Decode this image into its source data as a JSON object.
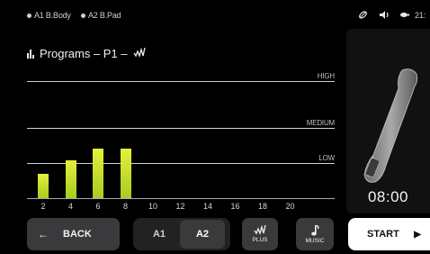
{
  "status": {
    "tag_a1": "A1 B.Body",
    "tag_a2": "A2 B.Pad",
    "clock": "21:"
  },
  "header": {
    "title": "Programs – P1 –"
  },
  "chart_data": {
    "type": "bar",
    "x_ticks": [
      "2",
      "4",
      "6",
      "8",
      "10",
      "12",
      "14",
      "16",
      "18",
      "20"
    ],
    "values": [
      1.0,
      1.55,
      2.05,
      2.05,
      null,
      null,
      null,
      null,
      null,
      null
    ],
    "levels": [
      "HIGH",
      "MEDIUM",
      "LOW"
    ],
    "colors": {
      "bar_top": "#e6ef3b",
      "bar_bottom": "#a6cd21"
    }
  },
  "device": {
    "timer": "08:00"
  },
  "controls": {
    "back_label": "BACK",
    "seg_a1": "A1",
    "seg_a2": "A2",
    "plus_label": "PLUS",
    "music_label": "MUSIC",
    "start_label": "START"
  },
  "colors": {
    "accent": "#c8e02e",
    "button_bg": "#3a3a3c",
    "start_bg": "#ffffff"
  }
}
